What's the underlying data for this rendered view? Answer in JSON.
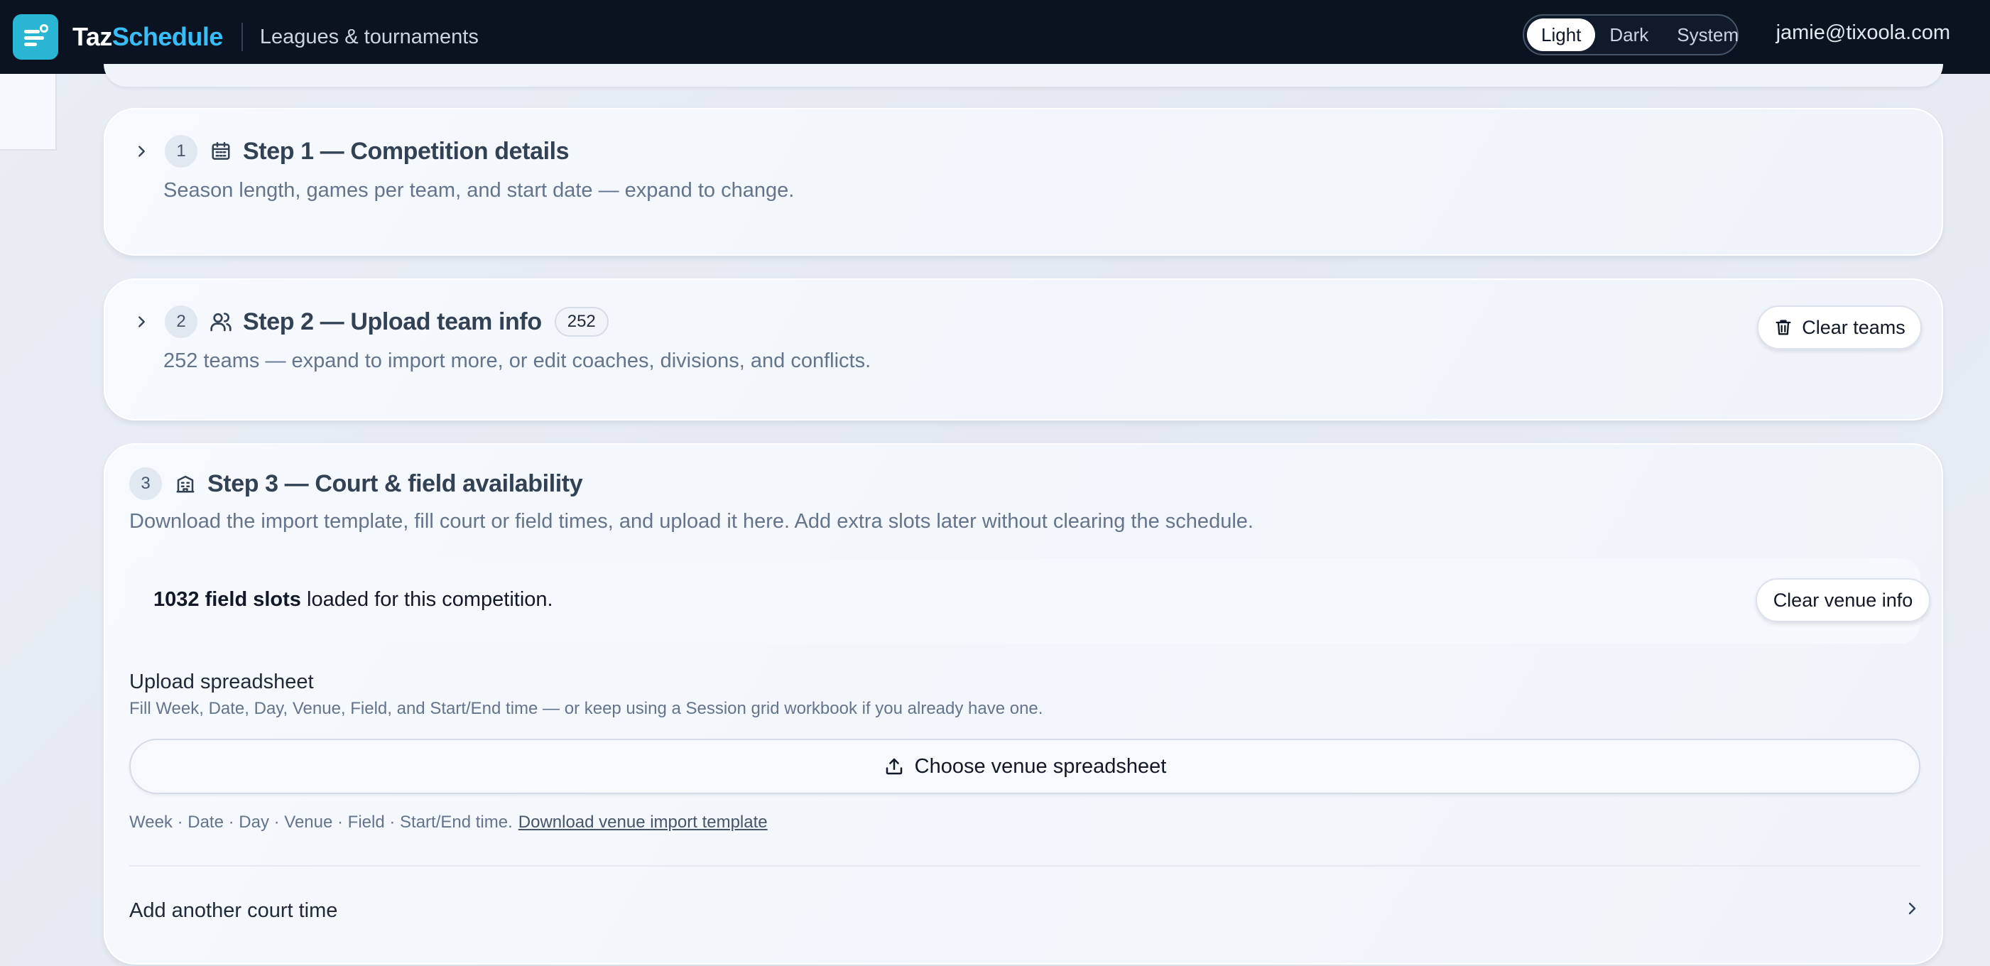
{
  "header": {
    "brand_part1": "Taz",
    "brand_part2": "Schedule",
    "section": "Leagues & tournaments",
    "theme_options": [
      "Light",
      "Dark",
      "System"
    ],
    "theme_selected": "Light",
    "user_email": "jamie@tixoola.com"
  },
  "steps": [
    {
      "number": "1",
      "icon": "calendar-icon",
      "title": "Step 1 — Competition details",
      "subtitle": "Season length, games per team, and start date — expand to change."
    },
    {
      "number": "2",
      "icon": "users-icon",
      "title": "Step 2 — Upload team info",
      "count": "252",
      "subtitle": "252 teams — expand to import more, or edit coaches, divisions, and conflicts.",
      "action_label": "Clear teams"
    },
    {
      "number": "3",
      "icon": "building-icon",
      "title": "Step 3 — Court & field availability",
      "subtitle": "Download the import template, fill court or field times, and upload it here. Add extra slots later without clearing the schedule.",
      "slots_count": "1032 field slots",
      "slots_suffix": " loaded for this competition.",
      "clear_venue_label": "Clear venue info",
      "upload_label": "Upload spreadsheet",
      "upload_help": "Fill Week, Date, Day, Venue, Field, and Start/End time — or keep using a Session grid workbook if you already have one.",
      "choose_label": "Choose venue spreadsheet",
      "columns_text": "Week · Date · Day · Venue · Field · Start/End time.",
      "template_link": "Download venue import template",
      "add_court_label": "Add another court time"
    }
  ],
  "colors": {
    "topbar": "#0b1220",
    "brand_accent": "#38bdf8",
    "logo_tile": "#29b6d5"
  }
}
